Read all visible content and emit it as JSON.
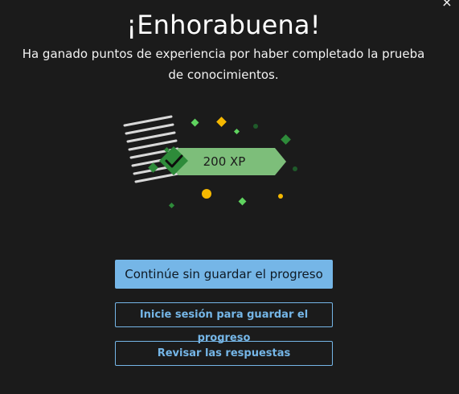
{
  "dialog": {
    "close_symbol": "×",
    "title": "¡Enhorabuena!",
    "subtitle": "Ha ganado puntos de experiencia por haber completado la prueba de conocimientos."
  },
  "badge": {
    "xp_text": "200 XP",
    "icon": "checkmark-icon"
  },
  "buttons": {
    "continue_label": "Continúe sin guardar el progreso",
    "signin_label": "Inicie sesión para guardar el progreso",
    "review_label": "Revisar las respuestas"
  },
  "colors": {
    "background": "#1b1b1b",
    "accent_blue": "#75b6e7",
    "badge_green": "#7dbe7a",
    "badge_dark_green": "#2e8b3a",
    "confetti_yellow": "#f5b800"
  }
}
